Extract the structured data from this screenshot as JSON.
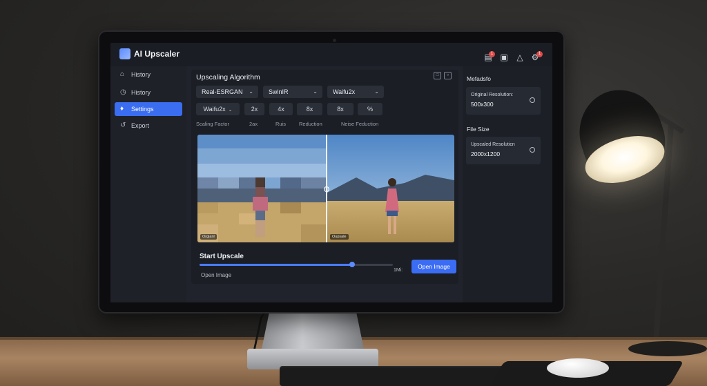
{
  "app": {
    "title": "AI Upscaler",
    "brand_color": "#3b6cf4",
    "topbar_icons": [
      {
        "icon": "inbox-icon",
        "badge": "1"
      },
      {
        "icon": "calendar-icon",
        "badge": ""
      },
      {
        "icon": "bell-icon",
        "badge": ""
      },
      {
        "icon": "settings-gear-icon",
        "badge": "1"
      }
    ]
  },
  "sidebar": {
    "items": [
      {
        "label": "History",
        "icon": "home-icon",
        "active": false
      },
      {
        "label": "History",
        "icon": "history-icon",
        "active": false
      },
      {
        "label": "Settings",
        "icon": "settings-icon",
        "active": true
      },
      {
        "label": "Export",
        "icon": "export-icon",
        "active": false
      }
    ]
  },
  "main": {
    "algorithm_title": "Upscaling Algorithm",
    "algorithms": [
      "Real-ESRGAN",
      "SwinIR",
      "Waifu2x"
    ],
    "chip_row": [
      "Waifu2x",
      "2x",
      "4x",
      "8x",
      "8x",
      "%"
    ],
    "labels": {
      "scaling_factor": "Scaling Factor",
      "col_2": "2ax",
      "col_3": "Ruis",
      "col_4": "Reduction",
      "col_5": "Neise Feduction"
    },
    "compare": {
      "left_tag": "Orgianl",
      "right_tag": "Oupsale"
    },
    "start_title": "Start Upscale",
    "progress": 0.79,
    "open_link": "Open Image",
    "size_value": "1Mi:",
    "open_button": "Open Image"
  },
  "right": {
    "metadata_title": "Mefadsfo",
    "original_label": "Original Resolution:",
    "original_value": "500x300",
    "file_size_title": "File Size",
    "upscaled_label": "Upscaled Resoluticn",
    "upscaled_value": "2000x1200"
  }
}
